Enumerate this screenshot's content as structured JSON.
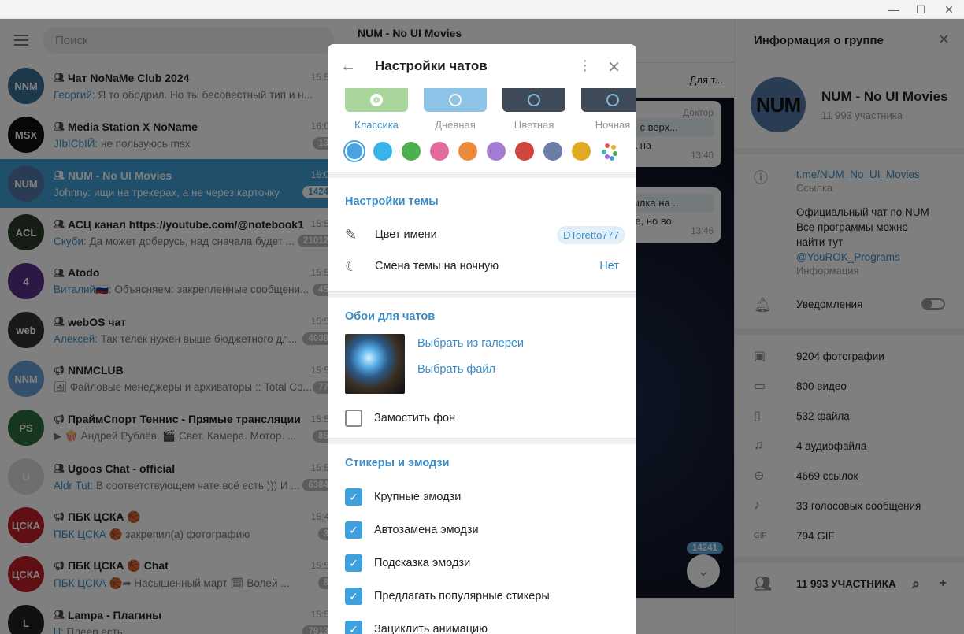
{
  "window": {
    "minimize_label": "—",
    "maximize_label": "☐",
    "close_label": "✕"
  },
  "sidebar": {
    "search_placeholder": "Поиск",
    "chats": [
      {
        "title": "Чат NoNaMe Club 2024",
        "type_icon": "group",
        "sender": "Георгий:",
        "message": "Я то ободрил. Но ты бесовестный тип и н...",
        "time": "15:5",
        "badge": "",
        "avatar_color": "#3b6f96",
        "avatar_text": "NNM"
      },
      {
        "title": "Media Station X NoName",
        "type_icon": "group",
        "sender": "JIbICbIЙ:",
        "message": "не пользуюсь msx",
        "time": "16:0",
        "badge": "13",
        "avatar_color": "#111111",
        "avatar_text": "MSX"
      },
      {
        "title": "NUM - No UI Movies",
        "type_icon": "group",
        "sender": "Johnny:",
        "message": "ищи на трекерах, а не через карточку",
        "time": "16:0",
        "badge": "1424",
        "avatar_color": "#5479a8",
        "avatar_text": "NUM",
        "active": true
      },
      {
        "title": "АСЦ канал https://youtube.com/@notebook1",
        "type_icon": "group",
        "sender": "Скуби:",
        "message": "Да может доберусь, над сначала будет ...",
        "time": "15:5",
        "badge": "21012",
        "avatar_color": "#2a3a2a",
        "avatar_text": "ACL"
      },
      {
        "title": "Atodo",
        "type_icon": "group",
        "sender": "Виталий🇷🇺:",
        "message": "Объясняем: закрепленные сообщени...",
        "time": "15:5",
        "badge": "45",
        "avatar_color": "#5a2f8a",
        "avatar_text": "4"
      },
      {
        "title": "webOS чат",
        "type_icon": "group",
        "sender": "Алексей:",
        "message": "Так телек нужен выше бюджетного дл...",
        "time": "15:5",
        "badge": "4038",
        "avatar_color": "#333333",
        "avatar_text": "web"
      },
      {
        "title": "NNMCLUB",
        "type_icon": "channel",
        "sender": "",
        "message": "🖼 Файловые менеджеры и архиваторы :: Total Co...",
        "time": "15:5",
        "badge": "77",
        "avatar_color": "#6aa0d8",
        "avatar_text": "NNM"
      },
      {
        "title": "ПраймСпорт Теннис - Прямые трансляции",
        "type_icon": "channel",
        "sender": "",
        "message": "▶ 🍿 Андрей Рублёв. 🎬 Свет. Камера. Мотор. ...",
        "time": "15:5",
        "badge": "85",
        "avatar_color": "#2c6e3a",
        "avatar_text": "PS"
      },
      {
        "title": "Ugoos Chat - official",
        "type_icon": "group",
        "sender": "Aldr Tut:",
        "message": "В соответствующем чате всё есть ))) И ...",
        "time": "15:5",
        "badge": "6384",
        "avatar_color": "#dddddd",
        "avatar_text": "U"
      },
      {
        "title": "ПБК ЦСКА 🏀",
        "type_icon": "channel",
        "sender": "ПБК ЦСКА 🏀",
        "message": "закрепил(а) фотографию",
        "time": "15:4",
        "badge": "3",
        "avatar_color": "#c0202a",
        "avatar_text": "ЦСКА"
      },
      {
        "title": "ПБК ЦСКА 🏀 Chat",
        "type_icon": "channel",
        "sender": "ПБК ЦСКА",
        "message": "🏀➦ Насыщенный март 🗓 Волей ...",
        "time": "15:5",
        "badge": "8",
        "avatar_color": "#c0202a",
        "avatar_text": "ЦСКА"
      },
      {
        "title": "Lampa - Плагины",
        "type_icon": "group",
        "sender": "lil:",
        "message": "Плеер есть",
        "time": "15:5",
        "badge": "7913",
        "avatar_color": "#222222",
        "avatar_text": "L"
      }
    ]
  },
  "middle": {
    "title": "NUM - No UI Movies",
    "pinned_text": "Для т...",
    "bubble1_author": "Доктор",
    "bubble1_quote": "начки с верх...",
    "bubble1_text": "ссылка на",
    "bubble1_time": "13:40",
    "bubble2_quote": "о, ссылка на ...",
    "bubble2_text": "закрепе, но во",
    "bubble2_time": "13:46",
    "unread_count": "14241"
  },
  "modal": {
    "title": "Настройки чатов",
    "themes": [
      {
        "label": "Классика",
        "color": "#a7d59b",
        "active": true
      },
      {
        "label": "Дневная",
        "color": "#8ec3e8",
        "active": false
      },
      {
        "label": "Цветная",
        "color": "#3f4a58",
        "active": false
      },
      {
        "label": "Ночная",
        "color": "#3f4a58",
        "active": false
      }
    ],
    "accent_colors": [
      "#4aa2de",
      "#3ab4e8",
      "#4cae4c",
      "#e26b9c",
      "#ec8a3c",
      "#a67bd4",
      "#d1463e",
      "#6a7ea8",
      "#e0ab22"
    ],
    "theme_settings_title": "Настройки темы",
    "name_color_label": "Цвет имени",
    "name_color_value": "DToretto777",
    "night_switch_label": "Смена темы на ночную",
    "night_switch_value": "Нет",
    "wallpaper_title": "Обои для чатов",
    "choose_gallery": "Выбрать из галереи",
    "choose_file": "Выбрать файл",
    "tile_label": "Замостить фон",
    "tile_checked": false,
    "stickers_title": "Стикеры и эмодзи",
    "options": [
      {
        "label": "Крупные эмодзи",
        "checked": true
      },
      {
        "label": "Автозамена эмодзи",
        "checked": true
      },
      {
        "label": "Подсказка эмодзи",
        "checked": true
      },
      {
        "label": "Предлагать популярные стикеры",
        "checked": true
      },
      {
        "label": "Зациклить анимацию",
        "checked": true
      }
    ]
  },
  "right": {
    "header": "Информация о группе",
    "avatar_text": "NUM",
    "name": "NUM - No UI Movies",
    "members": "11 993 участника",
    "link": "t.me/NUM_No_UI_Movies",
    "link_label": "Ссылка",
    "description_line1": "Официальный чат по NUM",
    "description_line2": "Все программы можно",
    "description_line3": "найти тут",
    "description_link": "@YouROK_Programs",
    "description_label": "Информация",
    "notifications_label": "Уведомления",
    "notifications_on": false,
    "media": [
      {
        "icon": "photo-icon",
        "glyph": "▣",
        "label": "9204 фотографии"
      },
      {
        "icon": "video-icon",
        "glyph": "▭",
        "label": "800 видео"
      },
      {
        "icon": "file-icon",
        "glyph": "▯",
        "label": "532 файла"
      },
      {
        "icon": "headphones-icon",
        "glyph": "♫",
        "label": "4 аудиофайла"
      },
      {
        "icon": "link-icon",
        "glyph": "⊖",
        "label": "4669 ссылок"
      },
      {
        "icon": "microphone-icon",
        "glyph": "♪",
        "label": "33 голосовых сообщения"
      },
      {
        "icon": "gif-icon",
        "glyph": "GIF",
        "label": "794 GIF"
      }
    ],
    "members_header": "11 993 УЧАСТНИКА"
  }
}
